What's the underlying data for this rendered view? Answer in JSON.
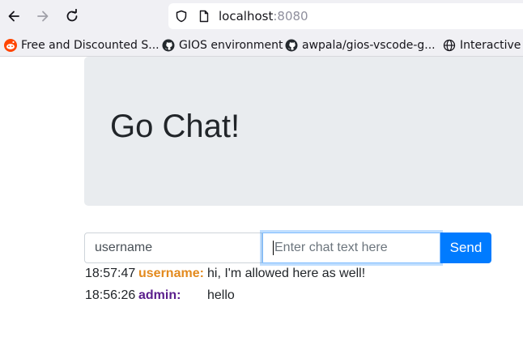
{
  "browser": {
    "url_host": "localhost",
    "url_port": ":8080",
    "bookmarks": [
      {
        "label": "Free and Discounted S...",
        "icon": "reddit-icon"
      },
      {
        "label": "GIOS environment",
        "icon": "github-icon"
      },
      {
        "label": "awpala/gios-vscode-g...",
        "icon": "github-icon"
      },
      {
        "label": "Interactive r",
        "icon": "globe-icon"
      }
    ]
  },
  "page": {
    "title": "Go Chat!",
    "username_value": "username",
    "chat_placeholder": "Enter chat text here",
    "send_label": "Send"
  },
  "messages": [
    {
      "time": "18:57:47",
      "user": "username:",
      "text": "hi, I'm allowed here as well!",
      "user_color": "#e38a1e"
    },
    {
      "time": "18:56:26",
      "user": "admin:",
      "text": "hello",
      "user_color": "#5a1e8c"
    }
  ],
  "colors": {
    "primary": "#007bff",
    "jumbotron_bg": "#e9ecef"
  }
}
